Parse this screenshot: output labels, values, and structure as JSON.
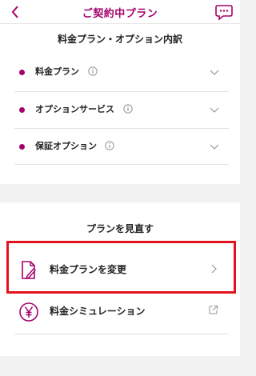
{
  "header": {
    "title": "ご契約中プラン"
  },
  "breakdown": {
    "title": "料金プラン・オプション内訳",
    "items": [
      {
        "label": "料金プラン"
      },
      {
        "label": "オプションサービス"
      },
      {
        "label": "保証オプション"
      }
    ]
  },
  "review": {
    "title": "プランを見直す",
    "change_label": "料金プランを変更",
    "simulation_label": "料金シミュレーション"
  },
  "colors": {
    "accent": "#a3006b",
    "highlight": "#e0141e"
  }
}
